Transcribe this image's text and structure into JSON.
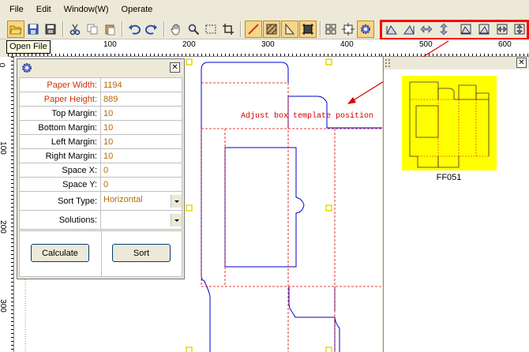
{
  "menu": {
    "file": "File",
    "edit": "Edit",
    "window": "Window(W)",
    "operate": "Operate"
  },
  "tooltip": "Open File",
  "ruler": {
    "top_labels": [
      "100",
      "200",
      "300",
      "400",
      "500",
      "600"
    ],
    "left_labels": [
      "0",
      "100",
      "200",
      "300"
    ]
  },
  "dialog": {
    "fields": [
      {
        "label": "Paper Width:",
        "value": "1194"
      },
      {
        "label": "Paper Height:",
        "value": "889"
      },
      {
        "label": "Top Margin:",
        "value": "10"
      },
      {
        "label": "Bottom Margin:",
        "value": "10"
      },
      {
        "label": "Left Margin:",
        "value": "10"
      },
      {
        "label": "Right Margin:",
        "value": "10"
      },
      {
        "label": "Space X:",
        "value": "0"
      },
      {
        "label": "Space Y:",
        "value": "0"
      }
    ],
    "sort_type_label": "Sort Type:",
    "sort_type_value": "Horizontal",
    "solutions_label": "Solutions:",
    "solutions_value": "",
    "calculate_label": "Calculate",
    "sort_label": "Sort"
  },
  "canvas": {
    "annotation": "Adjust box template position"
  },
  "template_panel": {
    "item_label": "FF051"
  },
  "colors": {
    "highlight": "#ff0000",
    "outline": "#0000cc",
    "fold_line": "#dd0000",
    "thumbnail_bg": "#ffff00",
    "handle": "#e6d800"
  }
}
